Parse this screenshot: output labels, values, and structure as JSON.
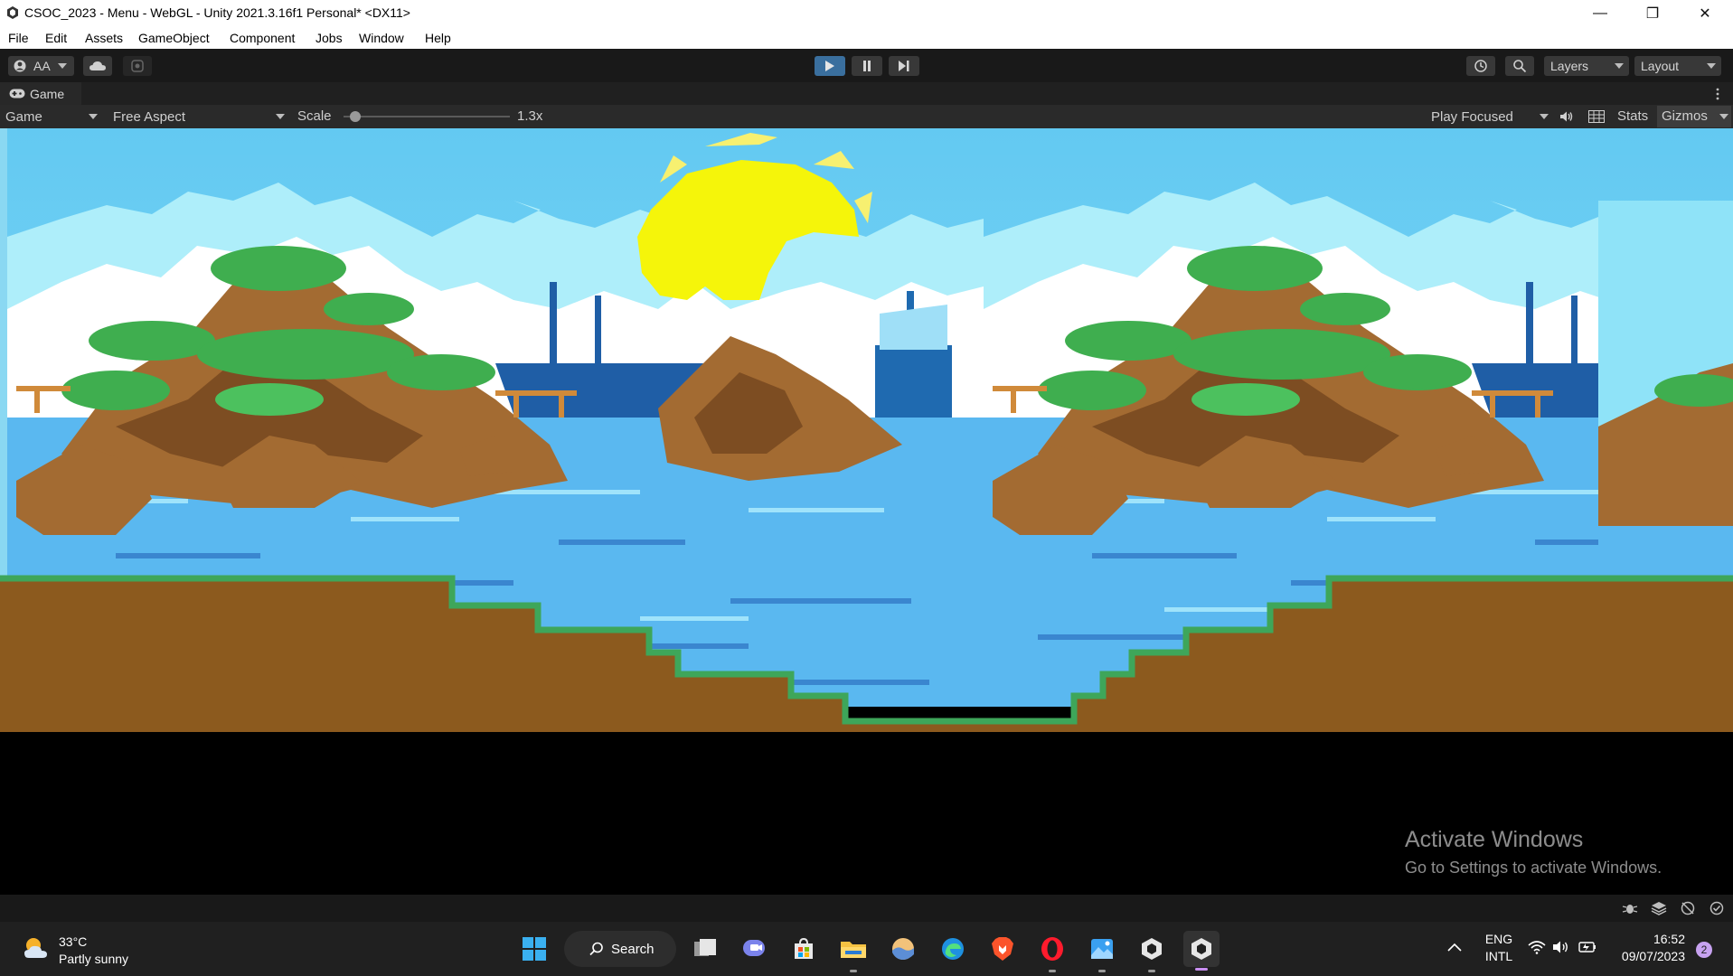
{
  "window": {
    "title": "CSOC_2023 - Menu - WebGL - Unity 2021.3.16f1 Personal* <DX11>",
    "controls": {
      "minimize": "—",
      "restore": "❐",
      "close": "✕"
    }
  },
  "menu": [
    "File",
    "Edit",
    "Assets",
    "GameObject",
    "Component",
    "Jobs",
    "Window",
    "Help"
  ],
  "toolbar": {
    "account_label": "AA",
    "layers_label": "Layers",
    "layout_label": "Layout",
    "play_icon": "play-icon",
    "pause_icon": "pause-icon",
    "step_icon": "step-icon",
    "play_active": true
  },
  "game_tab": {
    "label": "Game"
  },
  "game_controls": {
    "display": "Game",
    "aspect": "Free Aspect",
    "scale_label": "Scale",
    "scale_value": "1.3x",
    "scale_fraction": 0.07,
    "play_mode": "Play Focused",
    "stats": "Stats",
    "gizmos": "Gizmos"
  },
  "watermark": {
    "title": "Activate Windows",
    "subtitle": "Go to Settings to activate Windows."
  },
  "taskbar": {
    "weather_temp": "33°C",
    "weather_desc": "Partly sunny",
    "search_label": "Search",
    "language_1": "ENG",
    "language_2": "INTL",
    "time": "16:52",
    "date": "09/07/2023",
    "notification_count": "2"
  },
  "colors": {
    "sky": "#5cc8f0",
    "sea": "#5ab8f0",
    "sun": "#f5f50a",
    "dirt": "#8c5a1e",
    "grass": "#3ea65a",
    "unity_dark": "#191919"
  }
}
